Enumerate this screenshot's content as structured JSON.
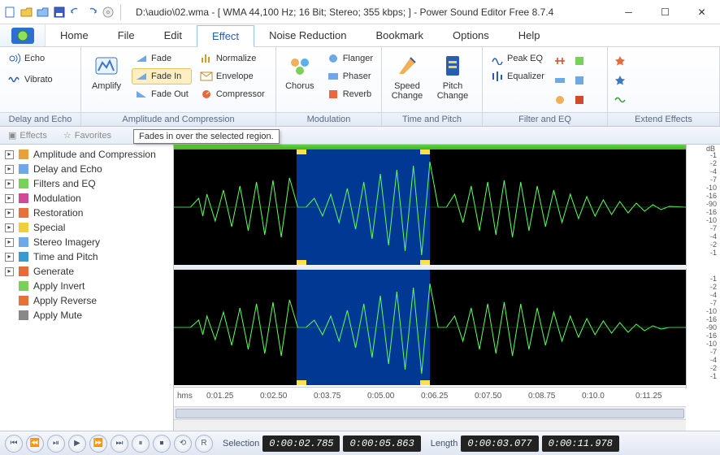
{
  "title": "D:\\audio\\02.wma - [ WMA 44,100 Hz; 16 Bit; Stereo; 355 kbps; ] - Power Sound Editor Free 8.7.4",
  "menu": {
    "home": "Home",
    "file": "File",
    "edit": "Edit",
    "effect": "Effect",
    "noise": "Noise Reduction",
    "bookmark": "Bookmark",
    "options": "Options",
    "help": "Help"
  },
  "ribbon": {
    "delay_echo": {
      "label": "Delay and Echo",
      "echo": "Echo",
      "vibrato": "Vibrato"
    },
    "amp_comp": {
      "label": "Amplitude and Compression",
      "amplify": "Amplify",
      "fade": "Fade",
      "fadein": "Fade In",
      "fadeout": "Fade Out",
      "normalize": "Normalize",
      "envelope": "Envelope",
      "compressor": "Compressor"
    },
    "modulation": {
      "label": "Modulation",
      "chorus": "Chorus",
      "flanger": "Flanger",
      "phaser": "Phaser",
      "reverb": "Reverb"
    },
    "time_pitch": {
      "label": "Time and Pitch",
      "speed": "Speed Change",
      "pitch": "Pitch Change"
    },
    "filter_eq": {
      "label": "Filter and EQ",
      "peakeq": "Peak EQ",
      "equalizer": "Equalizer"
    },
    "extend": {
      "label": "Extend Effects"
    }
  },
  "sidebar_tabs": {
    "effects": "Effects",
    "favorites": "Favorites"
  },
  "tooltip": "Fades in over the selected region.",
  "tree": [
    "Amplitude and Compression",
    "Delay and Echo",
    "Filters and EQ",
    "Modulation",
    "Restoration",
    "Special",
    "Stereo Imagery",
    "Time and Pitch",
    "Generate",
    "Apply Invert",
    "Apply Reverse",
    "Apply Mute"
  ],
  "tree_expandable": [
    true,
    true,
    true,
    true,
    true,
    true,
    true,
    true,
    true,
    false,
    false,
    false
  ],
  "db_top_label": "dB",
  "db_ticks": [
    "-1",
    "-2",
    "-4",
    "-7",
    "-10",
    "-16",
    "-90",
    "-16",
    "-10",
    "-7",
    "-4",
    "-2",
    "-1"
  ],
  "time_unit": "hms",
  "time_ticks": [
    "0:01.25",
    "0:02.50",
    "0:03.75",
    "0:05.00",
    "0:06.25",
    "0:07.50",
    "0:08.75",
    "0:10.0",
    "0:11.25"
  ],
  "status": {
    "selection_label": "Selection",
    "selection_start": "0:00:02.785",
    "selection_end": "0:00:05.863",
    "length_label": "Length",
    "length_sel": "0:00:03.077",
    "length_total": "0:00:11.978"
  },
  "transport": [
    "⏮",
    "⏪",
    "⏯",
    "▶",
    "⏩",
    "⏭",
    "⏸",
    "⏹",
    "⟲",
    "R"
  ]
}
